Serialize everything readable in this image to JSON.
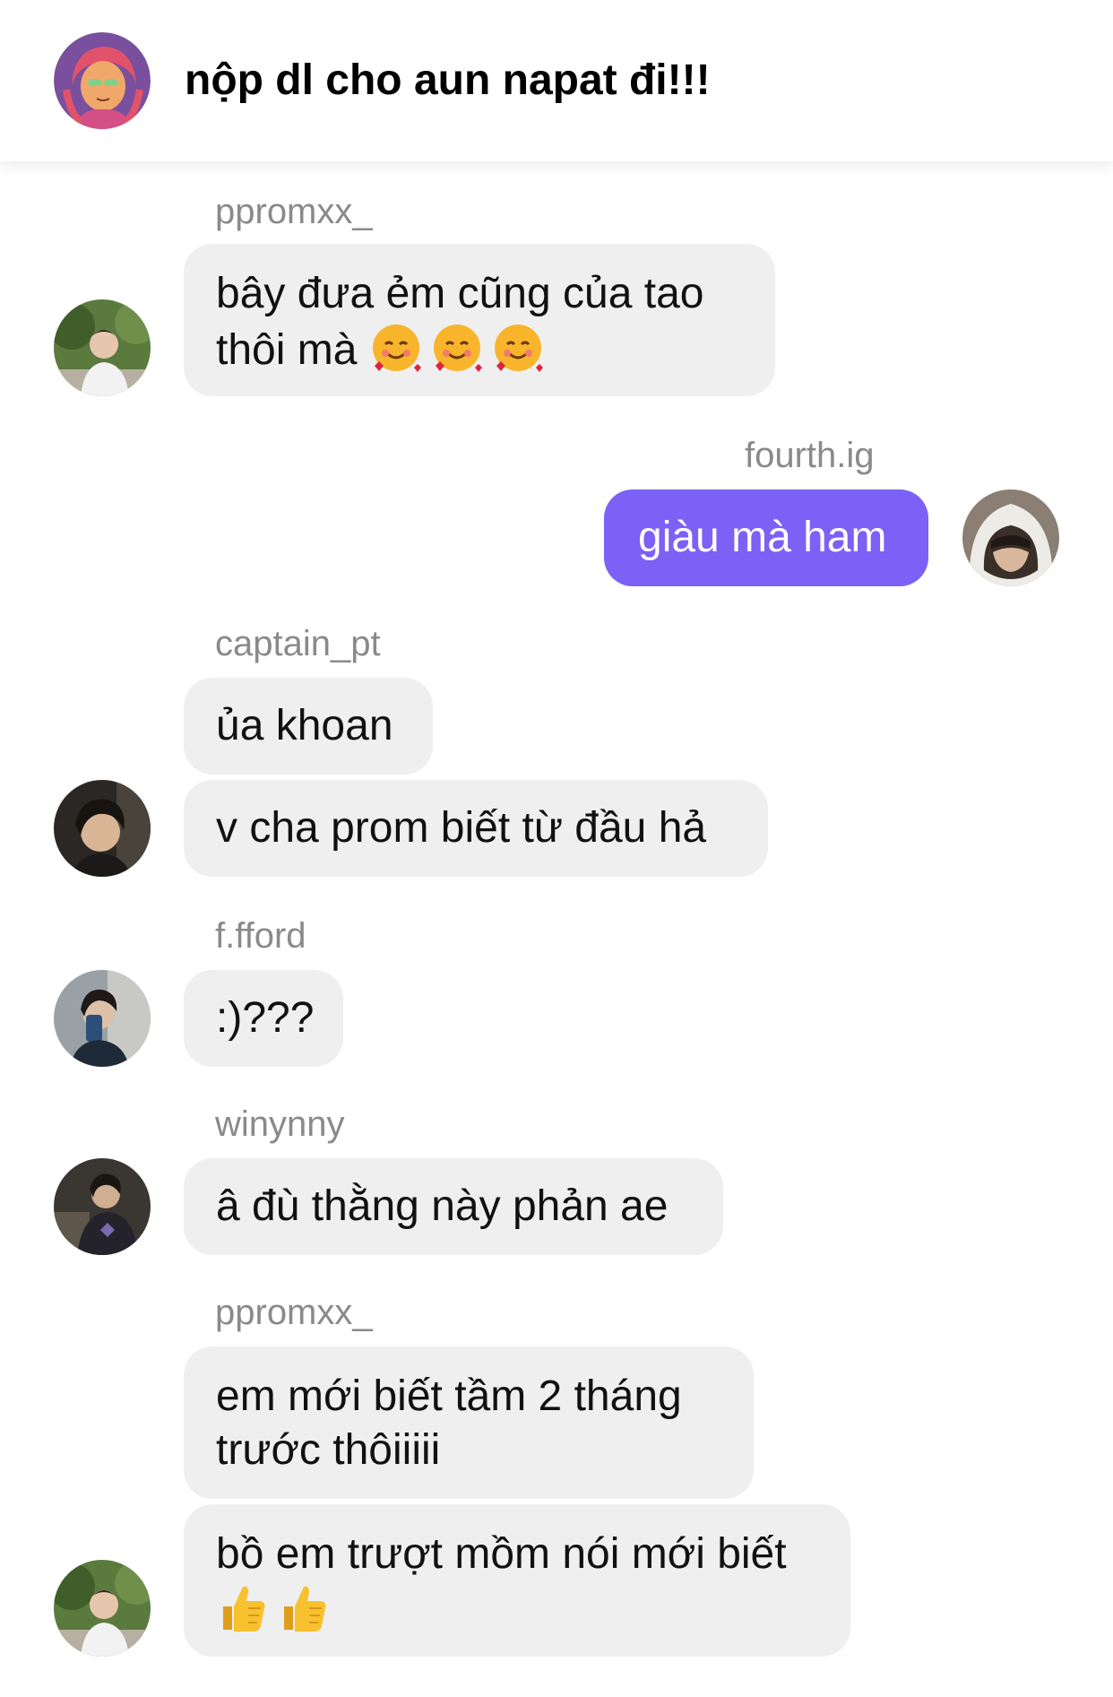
{
  "header": {
    "title": "nộp dl cho aun napat đi!!!",
    "avatar": "group-avatar-cartoon"
  },
  "colors": {
    "my_bubble": "#7b61f5",
    "other_bubble": "#efefef",
    "username": "#8a8a8a"
  },
  "messages": [
    {
      "sender": "ppromxx_",
      "bubbles": [
        {
          "text": "bây đưa ẻm cũng của tao thôi mà",
          "emoji": [
            "smiling-face-with-hearts-emoji",
            "smiling-face-with-hearts-emoji",
            "smiling-face-with-hearts-emoji"
          ]
        }
      ]
    },
    {
      "sender": "fourth.ig",
      "mine": true,
      "bubbles": [
        {
          "text": "giàu mà ham"
        }
      ]
    },
    {
      "sender": "captain_pt",
      "bubbles": [
        {
          "text": "ủa khoan"
        },
        {
          "text": "v cha prom biết từ đầu hả"
        }
      ]
    },
    {
      "sender": "f.fford",
      "bubbles": [
        {
          "text": ":)???"
        }
      ]
    },
    {
      "sender": "winynny",
      "bubbles": [
        {
          "text": "â đù thằng này phản ae"
        }
      ]
    },
    {
      "sender": "ppromxx_",
      "bubbles": [
        {
          "text": "em mới biết tầm 2 tháng trước thôiiiii"
        },
        {
          "text": "bồ em trượt mồm nói mới biết",
          "emoji": [
            "thumbs-up-emoji",
            "thumbs-up-emoji"
          ]
        }
      ]
    }
  ]
}
